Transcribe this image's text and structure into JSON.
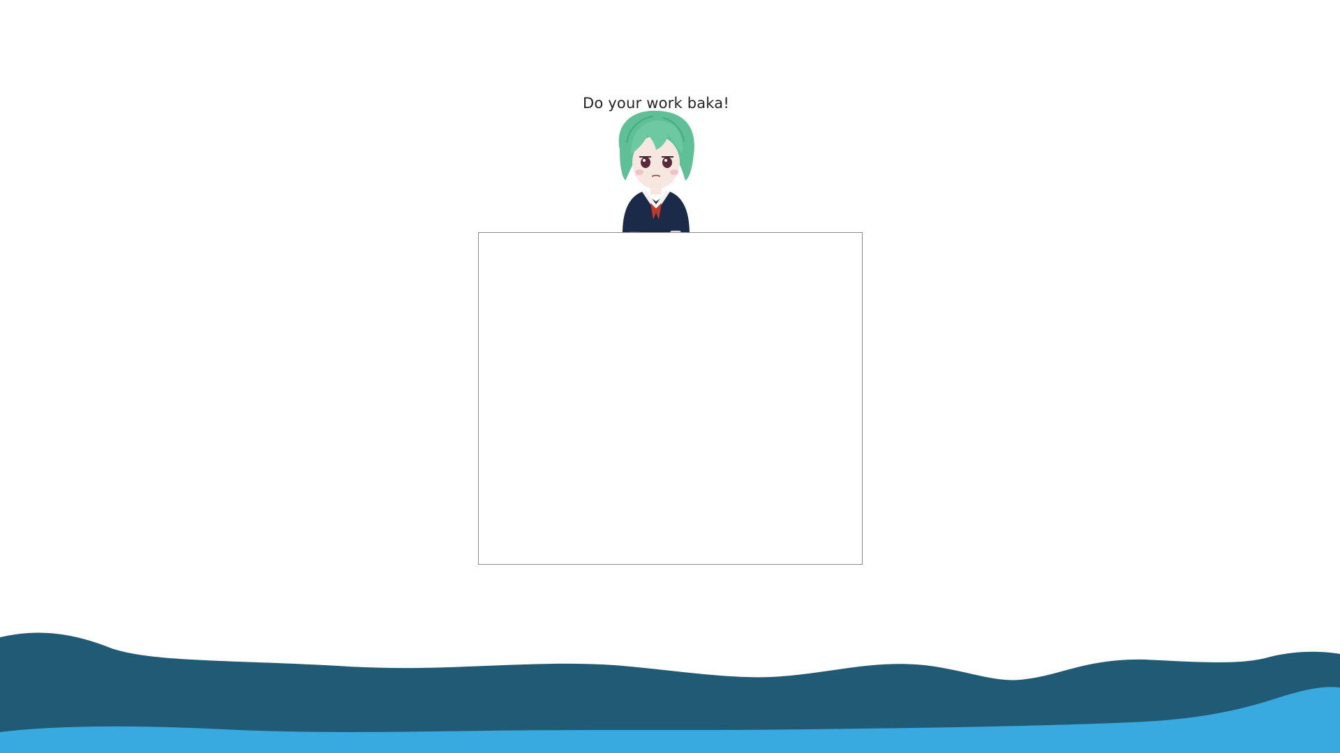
{
  "speech": {
    "text": "Do your work baka!"
  },
  "mascot": {
    "description_icon": "anime-girl-mascot-icon",
    "hair_color": "#5fbf97",
    "uniform_color": "#1c2a4a",
    "ribbon_color": "#c0392b"
  },
  "work_area": {
    "border_color": "#8a8a8a"
  },
  "waves": {
    "back_color": "#215a75",
    "front_color": "#38aadf"
  }
}
